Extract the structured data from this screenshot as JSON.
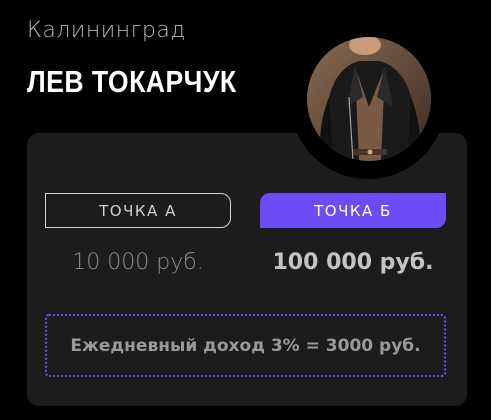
{
  "profile": {
    "city": "Калининград",
    "name": "ЛЕВ ТОКАРЧУК"
  },
  "tabs": {
    "a_label": "ТОЧКА А",
    "b_label": "ТОЧКА Б"
  },
  "amounts": {
    "a": "10 000 руб.",
    "b": "100 000 руб."
  },
  "income": {
    "text": "Ежедневный доход 3% = 3000 руб."
  },
  "colors": {
    "accent": "#6c4cf5",
    "background": "#000000",
    "card": "#1c1c1c"
  }
}
